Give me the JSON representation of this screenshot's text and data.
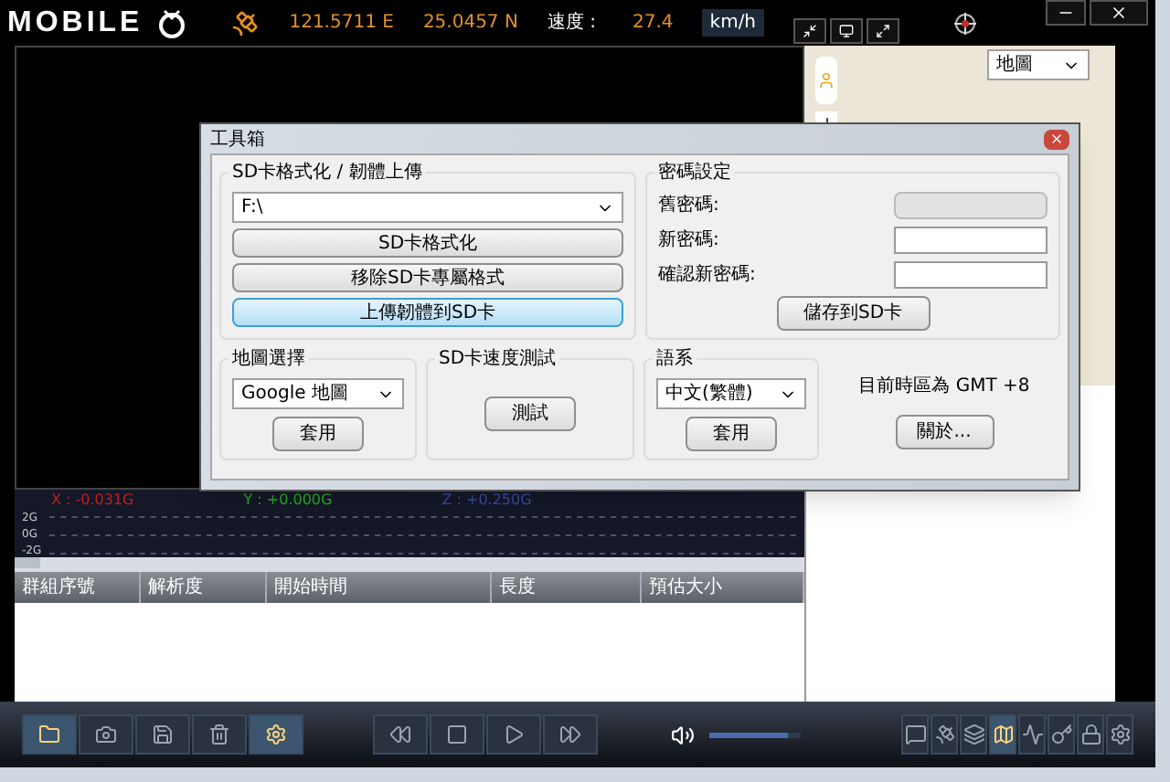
{
  "header": {
    "logo": "MOBILE",
    "longitude": "121.5711 E",
    "latitude": "25.0457 N",
    "speed_label": "速度 :",
    "speed": "27.4",
    "speed_unit": "km/h"
  },
  "map": {
    "type_select": "地圖"
  },
  "gsensor": {
    "x": "X : -0.031G",
    "y": "Y : +0.000G",
    "z": "Z : +0.250G",
    "scale": [
      "2G",
      "0G",
      "-2G"
    ]
  },
  "table": {
    "columns": [
      "群組序號",
      "解析度",
      "開始時間",
      "長度",
      "預估大小"
    ]
  },
  "toolbar": {
    "file_tools": [
      {
        "kind": "folder",
        "selected": true
      },
      {
        "kind": "camera",
        "selected": false
      },
      {
        "kind": "save",
        "selected": false
      },
      {
        "kind": "trash",
        "selected": false
      },
      {
        "kind": "gear",
        "selected": true
      }
    ],
    "playback": [
      {
        "kind": "rewind"
      },
      {
        "kind": "stop"
      },
      {
        "kind": "play"
      },
      {
        "kind": "forward"
      }
    ],
    "volume": {
      "level": 0.85
    },
    "view_tools": [
      {
        "kind": "chat",
        "selected": false
      },
      {
        "kind": "satellite",
        "selected": false
      },
      {
        "kind": "layers",
        "selected": false
      },
      {
        "kind": "map",
        "selected": true
      },
      {
        "kind": "wave",
        "selected": false
      },
      {
        "kind": "key",
        "selected": false
      },
      {
        "kind": "lock",
        "selected": false
      },
      {
        "kind": "gear",
        "selected": false
      }
    ]
  },
  "dialog": {
    "title": "工具箱",
    "sd_group": {
      "title": "SD卡格式化 / 韌體上傳",
      "drive": "F:\\",
      "buttons": [
        {
          "label": "SD卡格式化",
          "selected": false
        },
        {
          "label": "移除SD卡專屬格式",
          "selected": false
        },
        {
          "label": "上傳韌體到SD卡",
          "selected": true
        }
      ]
    },
    "password_group": {
      "title": "密碼設定",
      "fields": [
        {
          "label": "舊密碼:",
          "disabled": true
        },
        {
          "label": "新密碼:",
          "disabled": false
        },
        {
          "label": "確認新密碼:",
          "disabled": false
        }
      ],
      "save_button": "儲存到SD卡"
    },
    "map_group": {
      "title": "地圖選擇",
      "select": "Google 地圖",
      "apply": "套用"
    },
    "speed_group": {
      "title": "SD卡速度測試",
      "test": "測試"
    },
    "language_group": {
      "title": "語系",
      "select": "中文(繁體)",
      "apply": "套用"
    },
    "timezone": "目前時區為 GMT +8",
    "about": "關於..."
  }
}
